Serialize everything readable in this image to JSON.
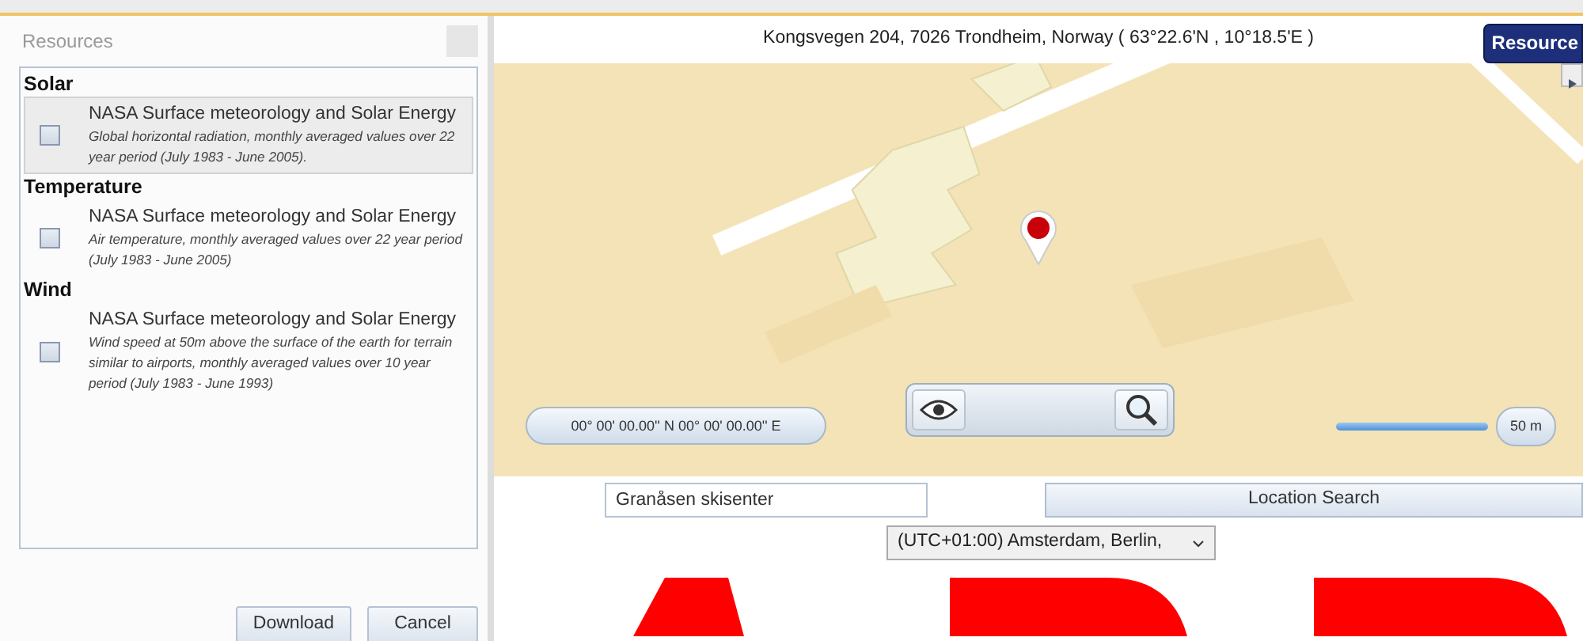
{
  "dialog": {
    "title": "Resources",
    "groups": [
      {
        "name": "Solar",
        "items": [
          {
            "title": "NASA Surface meteorology and Solar Energy",
            "description": "Global horizontal radiation, monthly averaged values over 22 year period (July 1983 - June 2005).",
            "checked": false,
            "selected": true
          }
        ]
      },
      {
        "name": "Temperature",
        "items": [
          {
            "title": "NASA Surface meteorology and Solar Energy",
            "description": "Air temperature, monthly averaged values over 22 year period (July 1983 - June 2005)",
            "checked": false,
            "selected": false
          }
        ]
      },
      {
        "name": "Wind",
        "items": [
          {
            "title": "NASA Surface meteorology and Solar Energy",
            "description": "Wind speed at 50m above the surface of the earth for terrain similar to airports, monthly averaged values over 10 year period (July 1983 - June 1993)",
            "checked": false,
            "selected": false
          }
        ]
      }
    ],
    "buttons": [
      "Download",
      "Cancel"
    ]
  },
  "location": {
    "address": "Kongsvegen 204, 7026 Trondheim, Norway ( 63°22.6'N , 10°18.5'E )",
    "resources_button": "Resource",
    "coordinates": "00° 00' 00.00'' N 00° 00' 00.00'' E",
    "scale": "50 m"
  },
  "search": {
    "value": "Granåsen skisenter",
    "button": "Location Search"
  },
  "timezone": {
    "value": "(UTC+01:00) Amsterdam, Berlin,"
  }
}
